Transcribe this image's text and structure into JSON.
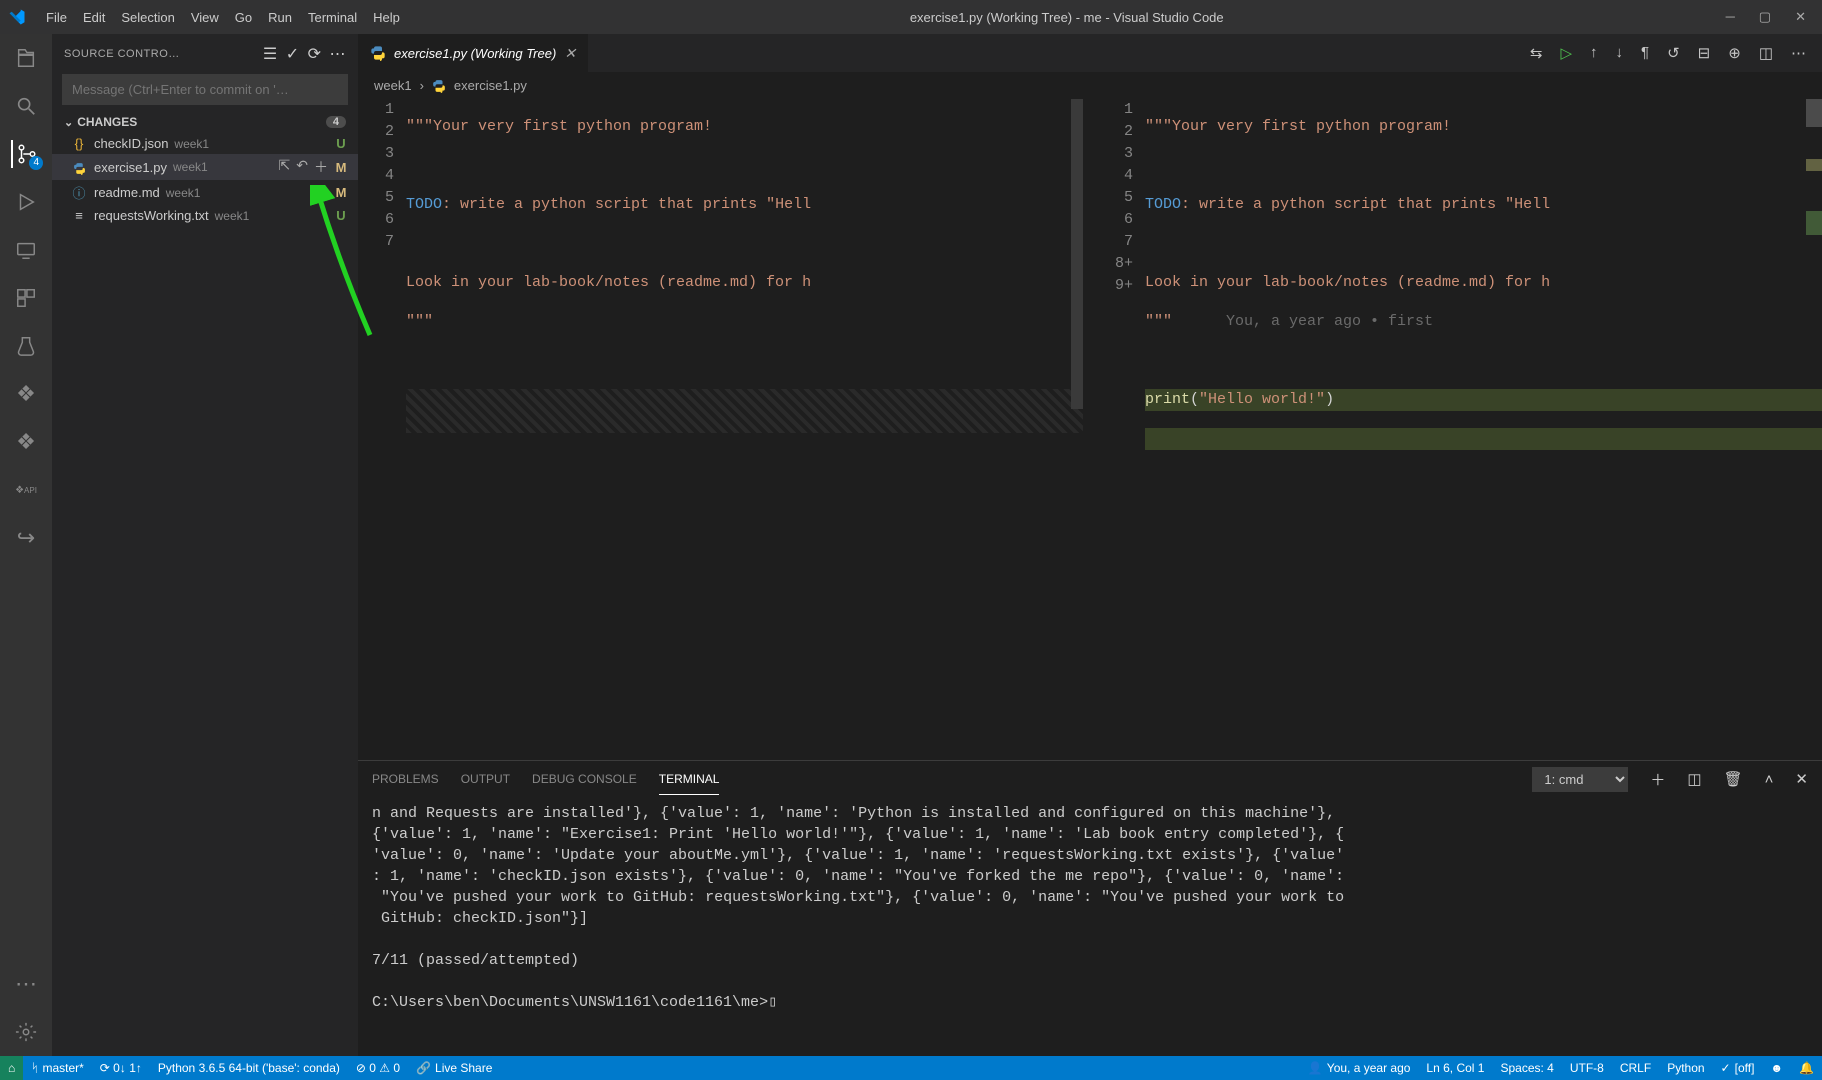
{
  "title": "exercise1.py (Working Tree) - me - Visual Studio Code",
  "menu": [
    "File",
    "Edit",
    "Selection",
    "View",
    "Go",
    "Run",
    "Terminal",
    "Help"
  ],
  "activity_badge": "4",
  "sidebar": {
    "title": "SOURCE CONTRO…",
    "input_placeholder": "Message (Ctrl+Enter to commit on '…",
    "section": "CHANGES",
    "count": "4",
    "files": [
      {
        "icon": "{}",
        "iconColor": "#e8b339",
        "name": "checkID.json",
        "dir": "week1",
        "status": "U"
      },
      {
        "icon": "py",
        "iconColor": "#519aba",
        "name": "exercise1.py",
        "dir": "week1",
        "status": "M",
        "selected": true,
        "actions": true
      },
      {
        "icon": "ⓘ",
        "iconColor": "#519aba",
        "name": "readme.md",
        "dir": "week1",
        "status": "M"
      },
      {
        "icon": "≡",
        "iconColor": "#cccccc",
        "name": "requestsWorking.txt",
        "dir": "week1",
        "status": "U"
      }
    ]
  },
  "tab": {
    "label": "exercise1.py (Working Tree)"
  },
  "breadcrumb": {
    "dir": "week1",
    "file": "exercise1.py"
  },
  "code_left": {
    "lines": [
      "1",
      "2",
      "3",
      "4",
      "5",
      "6",
      "7"
    ]
  },
  "code_right": {
    "lines": [
      "1",
      "2",
      "3",
      "4",
      "5",
      "6",
      "7",
      "8+",
      "9+"
    ]
  },
  "codetext": {
    "l1": "\"\"\"Your very first python program!",
    "l3a": "TODO",
    "l3b": ": write a python script that prints \"Hell",
    "l3b_r": ": write a python script that prints \"Hell",
    "l5": "Look in your lab-book/notes (readme.md) for h",
    "l5_r": "Look in your lab-book/notes (readme.md) for h",
    "l6": "\"\"\"",
    "lens": "You, a year ago • first",
    "l8a": "print",
    "l8b": "(",
    "l8c": "\"Hello world!\"",
    "l8d": ")"
  },
  "panel": {
    "tabs": [
      "PROBLEMS",
      "OUTPUT",
      "DEBUG CONSOLE",
      "TERMINAL"
    ],
    "active": "TERMINAL",
    "selector": "1: cmd",
    "body": "n and Requests are installed'}, {'value': 1, 'name': 'Python is installed and configured on this machine'},\n{'value': 1, 'name': \"Exercise1: Print 'Hello world!'\"}, {'value': 1, 'name': 'Lab book entry completed'}, {\n'value': 0, 'name': 'Update your aboutMe.yml'}, {'value': 1, 'name': 'requestsWorking.txt exists'}, {'value'\n: 1, 'name': 'checkID.json exists'}, {'value': 0, 'name': \"You've forked the me repo\"}, {'value': 0, 'name':\n \"You've pushed your work to GitHub: requestsWorking.txt\"}, {'value': 0, 'name': \"You've pushed your work to\n GitHub: checkID.json\"}]\n\n7/11 (passed/attempted)\n\nC:\\Users\\ben\\Documents\\UNSW1161\\code1161\\me>▯"
  },
  "status": {
    "branch": "master*",
    "sync": "⟳ 0↓ 1↑",
    "python": "Python 3.6.5 64-bit ('base': conda)",
    "errors": "⊘ 0 ⚠ 0",
    "liveshare": "Live Share",
    "blame": "You, a year ago",
    "pos": "Ln 6, Col 1",
    "spaces": "Spaces: 4",
    "enc": "UTF-8",
    "eol": "CRLF",
    "lang": "Python",
    "formatter": "[off]"
  }
}
